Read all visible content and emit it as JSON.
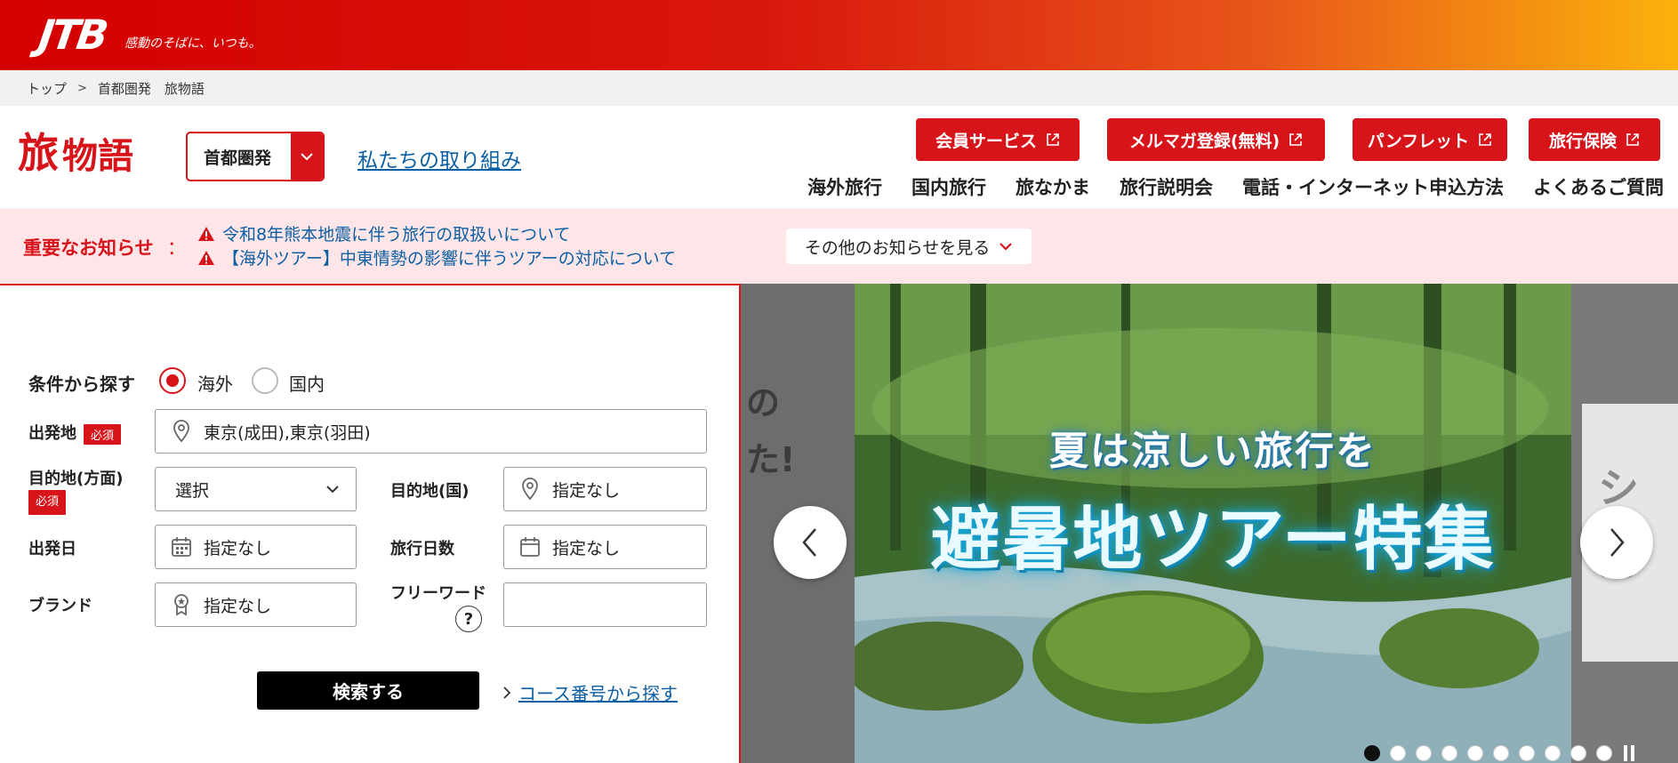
{
  "header": {
    "logo_text": "JTB",
    "tagline": "感動のそばに、いつも。",
    "gradient_colors": [
      "#d40000",
      "#fbb10c"
    ]
  },
  "breadcrumb": {
    "items": [
      "トップ",
      "首都圏発　旅物語"
    ]
  },
  "brand": {
    "logo_part1": "旅",
    "logo_part2": "物語",
    "region_select": "首都圏発",
    "initiative_link": "私たちの取り組み"
  },
  "service_buttons": [
    {
      "label": "会員サービス"
    },
    {
      "label": "メルマガ登録(無料)"
    },
    {
      "label": "パンフレット"
    },
    {
      "label": "旅行保険"
    }
  ],
  "global_nav": [
    "海外旅行",
    "国内旅行",
    "旅なかま",
    "旅行説明会",
    "電話・インターネット申込方法",
    "よくあるご質問"
  ],
  "notice": {
    "title": "重要なお知らせ",
    "colon": "：",
    "items": [
      "令和8年熊本地震に伴う旅行の取扱いについて",
      "【海外ツアー】中東情勢の影響に伴うツアーの対応について"
    ],
    "more_button": "その他のお知らせを見る"
  },
  "search": {
    "heading": "条件から探す",
    "radio_overseas": "海外",
    "radio_domestic": "国内",
    "selected_radio": "海外",
    "required_badge": "必須",
    "departure_label": "出発地",
    "departure_value": "東京(成田),東京(羽田)",
    "dest_area_label": "目的地(方面)",
    "dest_area_value": "選択",
    "dest_country_label": "目的地(国)",
    "dest_country_value": "指定なし",
    "date_label": "出発日",
    "date_value": "指定なし",
    "days_label": "旅行日数",
    "days_value": "指定なし",
    "brand_label": "ブランド",
    "brand_value": "指定なし",
    "freeword_label": "フリーワード",
    "freeword_help": "?",
    "freeword_value": "",
    "submit": "検索する",
    "course_link": "コース番号から探す"
  },
  "carousel": {
    "left_slide_text": "の\nた!",
    "right_slide_text": "シ\n海",
    "banner_sub": "夏は涼しい旅行を",
    "banner_main": "避暑地ツアー特集",
    "slide_count": 10,
    "active_index": 0
  },
  "colors": {
    "brand_red": "#d7141a",
    "link_blue": "#0b5fa5",
    "notice_bg": "#fde5e8"
  }
}
